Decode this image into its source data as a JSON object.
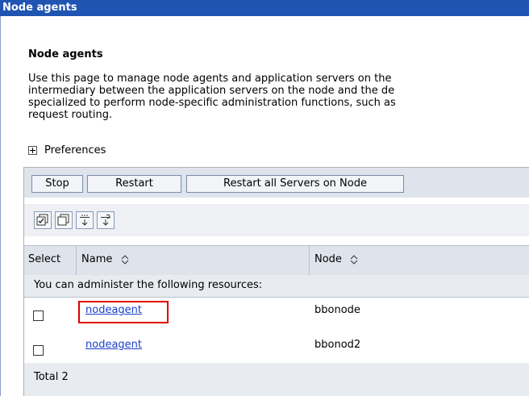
{
  "window": {
    "title": "Node agents"
  },
  "page": {
    "heading": "Node agents",
    "description_lines": [
      "Use this page to manage node agents and application servers on the",
      "intermediary between the application servers on the node and the de",
      "specialized to perform node-specific administration functions, such as",
      "request routing."
    ]
  },
  "preferences": {
    "label": "Preferences"
  },
  "toolbar": {
    "stop_label": "Stop",
    "restart_label": "Restart",
    "restart_all_label": "Restart all Servers on Node"
  },
  "icons": [
    "select-all-icon",
    "deselect-all-icon",
    "show-filter-icon",
    "clear-filter-icon"
  ],
  "table": {
    "columns": [
      "Select",
      "Name",
      "Node"
    ],
    "caption": "You can administer the following resources:",
    "rows": [
      {
        "name": "nodeagent",
        "node": "bbonode"
      },
      {
        "name": "nodeagent",
        "node": "bbonod2"
      }
    ],
    "total": "Total 2"
  },
  "colors": {
    "titlebar": "#1f54b3",
    "link": "#1a3fcc",
    "highlight": "#e00000"
  }
}
